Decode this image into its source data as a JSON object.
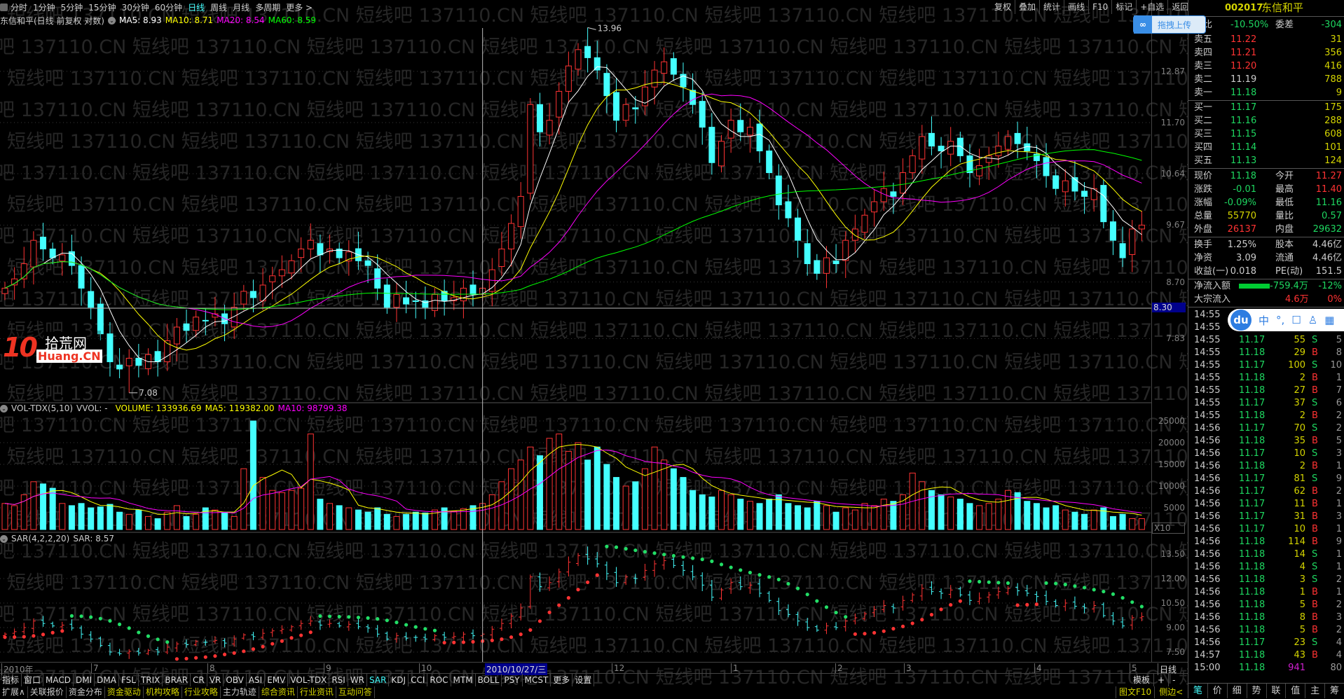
{
  "watermark": "短线吧 137110.CN",
  "top_menu": {
    "left": [
      "分时",
      "1分钟",
      "5分钟",
      "15分钟",
      "30分钟",
      "60分钟",
      "日线",
      "周线",
      "月线",
      "多周期",
      "更多 >"
    ],
    "active": "日线",
    "right": [
      "复权",
      "叠加",
      "统计",
      "画线",
      "F10",
      "标记",
      "+自选",
      "返回"
    ]
  },
  "title": {
    "name": "东信和平(日线 前复权 对数)",
    "ma5": "MA5: 8.93",
    "ma10": "MA10: 8.71",
    "ma20": "MA20: 8.54",
    "ma60": "MA60: 8.59"
  },
  "vol_title": {
    "name": "VOL-TDX(5,10)",
    "vvol": "VVOL: -",
    "volume": "VOLUME: 133936.69",
    "ma5": "MA5: 119382.00",
    "ma10": "MA10: 98799.38"
  },
  "sar_title": {
    "name": "SAR(4,2,2,20)",
    "sar": "SAR: 8.57"
  },
  "colors": {
    "up": "#ff3333",
    "down": "#44ffff",
    "ma5": "#ffffff",
    "ma10": "#ffff00",
    "ma20": "#ff00ff",
    "ma60": "#00ff00"
  },
  "upload_button": "拖拽上传",
  "logo": {
    "text1": "10",
    "text2": "拾荒网",
    "text3": "Huang.CN"
  },
  "chart_data": {
    "type": "candlestick",
    "scale": "log",
    "price_axis": [
      "12.87",
      "11.70",
      "10.64",
      "9.67",
      "8.70",
      "7.83"
    ],
    "crosshair_price": "8.30",
    "max_label": "13.96",
    "min_label": "7.08",
    "vol_axis": [
      "25000",
      "20000",
      "15000",
      "10000",
      "5000"
    ],
    "vol_multiplier": "X10",
    "sar_axis": [
      "13.50",
      "12.00",
      "10.50",
      "9.00",
      "7.50"
    ],
    "x_labels": [
      "2010年",
      "7",
      "8",
      "9",
      "10",
      "12",
      "1",
      "2",
      "3",
      "4",
      "5"
    ],
    "crosshair_date": "2010/10/27/三",
    "period_label": "日线",
    "close": [
      8.6,
      8.75,
      9.0,
      9.4,
      9.25,
      9.1,
      9.15,
      8.97,
      8.6,
      8.3,
      7.9,
      7.5,
      7.4,
      7.55,
      7.45,
      7.6,
      7.5,
      7.8,
      8.0,
      7.95,
      8.15,
      8.1,
      8.2,
      8.05,
      8.3,
      8.55,
      8.45,
      8.65,
      8.8,
      8.9,
      9.05,
      9.25,
      9.4,
      9.15,
      9.25,
      9.1,
      9.2,
      9.05,
      8.97,
      8.6,
      8.3,
      8.5,
      8.35,
      8.4,
      8.3,
      8.5,
      8.4,
      8.45,
      8.6,
      8.5,
      8.6,
      8.9,
      9.25,
      9.7,
      10.2,
      12.1,
      11.5,
      11.75,
      12.4,
      13.0,
      13.4,
      13.2,
      12.9,
      12.3,
      11.75,
      12.1,
      12.0,
      12.5,
      12.9,
      13.1,
      12.8,
      12.5,
      12.1,
      11.6,
      10.86,
      11.3,
      11.75,
      11.5,
      11.6,
      11.1,
      10.66,
      10.04,
      9.8,
      9.4,
      9.0,
      8.84,
      9.1,
      9.0,
      9.4,
      9.6,
      9.85,
      10.1,
      10.35,
      10.2,
      10.66,
      11.0,
      11.4,
      11.2,
      11.1,
      11.3,
      11.0,
      10.66,
      10.8,
      11.0,
      11.2,
      11.4,
      11.25,
      11.1,
      10.9,
      10.6,
      10.35,
      10.5,
      10.3,
      10.2,
      10.35,
      9.73,
      9.4,
      9.1,
      9.6,
      9.67
    ],
    "volume": [
      6000,
      5500,
      8000,
      11000,
      10500,
      9500,
      6000,
      5500,
      6000,
      5000,
      5200,
      5800,
      4000,
      3500,
      4500,
      3000,
      2500,
      4000,
      5500,
      3000,
      3500,
      5000,
      4500,
      4000,
      3000,
      14000,
      25000,
      12000,
      9000,
      8500,
      9000,
      9500,
      22000,
      7000,
      6000,
      5500,
      5000,
      4500,
      4000,
      5000,
      3500,
      3000,
      3500,
      4000,
      3800,
      4500,
      5000,
      4200,
      4800,
      5500,
      6000,
      8000,
      11000,
      14000,
      16000,
      19000,
      17000,
      21000,
      22000,
      18000,
      20000,
      16000,
      19000,
      15000,
      12000,
      10000,
      11000,
      14000,
      19000,
      16000,
      14000,
      12000,
      9000,
      8000,
      7500,
      9000,
      8000,
      7000,
      6500,
      6000,
      7000,
      8000,
      6000,
      5500,
      5000,
      6500,
      5500,
      4000,
      5000,
      4500,
      6000,
      5500,
      7000,
      6500,
      8000,
      13000,
      11000,
      9000,
      8000,
      7500,
      7000,
      6000,
      5500,
      6000,
      7000,
      9000,
      8500,
      6500,
      6000,
      5000,
      5500,
      4500,
      4000,
      3500,
      4500,
      5000,
      3000,
      3500,
      2500,
      2500
    ]
  },
  "tabs": [
    "指标",
    "窗口",
    "MACD",
    "DMI",
    "DMA",
    "FSL",
    "TRIX",
    "BRAR",
    "CR",
    "VR",
    "OBV",
    "ASI",
    "EMV",
    "VOL-TDX",
    "RSI",
    "WR",
    "SAR",
    "KDJ",
    "CCI",
    "ROC",
    "MTM",
    "BOLL",
    "PSY",
    "MCST",
    "更多",
    "设置"
  ],
  "active_tab": "SAR",
  "template": {
    "label": "模板",
    "plus": "+",
    "minus": "-"
  },
  "ext": [
    {
      "t": "扩展∧",
      "c": "w"
    },
    {
      "t": "关联报价",
      "c": "w"
    },
    {
      "t": "资金分布",
      "c": "w"
    },
    {
      "t": "资金驱动",
      "c": "y"
    },
    {
      "t": "机构攻略",
      "c": "y"
    },
    {
      "t": "行业攻略",
      "c": "y"
    },
    {
      "t": "主力轨迹",
      "c": "w"
    },
    {
      "t": "综合资讯",
      "c": "y"
    },
    {
      "t": "行业资讯",
      "c": "y"
    },
    {
      "t": "互动问答",
      "c": "y"
    }
  ],
  "ext_right": {
    "f10": "图文F10",
    "side": "侧边<"
  },
  "quote": {
    "code": "002017",
    "name": "东信和平",
    "wb_label": "委比",
    "wb": "-10.50%",
    "wc_label": "委差",
    "wc": "-304",
    "sell": [
      {
        "l": "卖五",
        "p": "11.22",
        "pc": "r",
        "v": "31"
      },
      {
        "l": "卖四",
        "p": "11.21",
        "pc": "r",
        "v": "356"
      },
      {
        "l": "卖三",
        "p": "11.20",
        "pc": "r",
        "v": "416"
      },
      {
        "l": "卖二",
        "p": "11.19",
        "pc": "w",
        "v": "788"
      },
      {
        "l": "卖一",
        "p": "11.18",
        "pc": "g",
        "v": "9"
      }
    ],
    "buy": [
      {
        "l": "买一",
        "p": "11.17",
        "pc": "g",
        "v": "175"
      },
      {
        "l": "买二",
        "p": "11.16",
        "pc": "g",
        "v": "288"
      },
      {
        "l": "买三",
        "p": "11.15",
        "pc": "g",
        "v": "608"
      },
      {
        "l": "买四",
        "p": "11.14",
        "pc": "g",
        "v": "101"
      },
      {
        "l": "买五",
        "p": "11.13",
        "pc": "g",
        "v": "124"
      }
    ],
    "stats": [
      {
        "l1": "现价",
        "v1": "11.18",
        "c1": "g",
        "l2": "今开",
        "v2": "11.27",
        "c2": "r"
      },
      {
        "l1": "涨跌",
        "v1": "-0.01",
        "c1": "g",
        "l2": "最高",
        "v2": "11.40",
        "c2": "r"
      },
      {
        "l1": "涨幅",
        "v1": "-0.09%",
        "c1": "g",
        "l2": "最低",
        "v2": "11.16",
        "c2": "g"
      },
      {
        "l1": "总量",
        "v1": "55770",
        "c1": "y",
        "l2": "量比",
        "v2": "0.57",
        "c2": "g"
      },
      {
        "l1": "外盘",
        "v1": "26137",
        "c1": "r",
        "l2": "内盘",
        "v2": "29632",
        "c2": "g"
      }
    ],
    "fund": [
      {
        "l1": "换手",
        "v1": "1.25%",
        "l2": "股本",
        "v2": "4.46亿"
      },
      {
        "l1": "净资",
        "v1": "3.09",
        "l2": "流通",
        "v2": "4.46亿"
      },
      {
        "l1": "收益(一)",
        "v1": "0.018",
        "l2": "PE(动)",
        "v2": "151.5"
      }
    ],
    "netflow": {
      "label": "净流入额",
      "value": "-759.4万",
      "pct": "-12%"
    },
    "block": {
      "label": "大宗流入",
      "value": "4.6万",
      "pct": "0%"
    }
  },
  "ticks": [
    {
      "t": "14:55",
      "p": "",
      "v": "",
      "d": "",
      "n": ""
    },
    {
      "t": "14:55",
      "p": "",
      "v": "",
      "d": "",
      "n": ""
    },
    {
      "t": "14:55",
      "p": "11.17",
      "v": "55",
      "d": "S",
      "n": "5"
    },
    {
      "t": "14:55",
      "p": "11.18",
      "v": "29",
      "d": "B",
      "n": "8"
    },
    {
      "t": "14:55",
      "p": "11.17",
      "v": "100",
      "d": "S",
      "n": "10"
    },
    {
      "t": "14:55",
      "p": "11.18",
      "v": "2",
      "d": "B",
      "n": "1"
    },
    {
      "t": "14:55",
      "p": "11.18",
      "v": "27",
      "d": "B",
      "n": "7"
    },
    {
      "t": "14:55",
      "p": "11.17",
      "v": "37",
      "d": "S",
      "n": "6"
    },
    {
      "t": "14:55",
      "p": "11.18",
      "v": "2",
      "d": "B",
      "n": "2"
    },
    {
      "t": "14:56",
      "p": "11.17",
      "v": "70",
      "d": "S",
      "n": "2"
    },
    {
      "t": "14:56",
      "p": "11.18",
      "v": "35",
      "d": "B",
      "n": "5"
    },
    {
      "t": "14:56",
      "p": "11.17",
      "v": "10",
      "d": "S",
      "n": "3"
    },
    {
      "t": "14:56",
      "p": "11.18",
      "v": "2",
      "d": "B",
      "n": "1"
    },
    {
      "t": "14:56",
      "p": "11.17",
      "v": "81",
      "d": "S",
      "n": "9"
    },
    {
      "t": "14:56",
      "p": "11.17",
      "v": "62",
      "d": "B",
      "n": "2"
    },
    {
      "t": "14:56",
      "p": "11.17",
      "v": "11",
      "d": "B",
      "n": "1"
    },
    {
      "t": "14:56",
      "p": "11.17",
      "v": "31",
      "d": "B",
      "n": "3"
    },
    {
      "t": "14:56",
      "p": "11.17",
      "v": "10",
      "d": "B",
      "n": "1"
    },
    {
      "t": "14:56",
      "p": "11.18",
      "v": "114",
      "d": "B",
      "n": "9"
    },
    {
      "t": "14:56",
      "p": "11.18",
      "v": "14",
      "d": "S",
      "n": "1"
    },
    {
      "t": "14:56",
      "p": "11.18",
      "v": "4",
      "d": "S",
      "n": "1"
    },
    {
      "t": "14:56",
      "p": "11.18",
      "v": "3",
      "d": "S",
      "n": "2"
    },
    {
      "t": "14:56",
      "p": "11.18",
      "v": "1",
      "d": "B",
      "n": "1"
    },
    {
      "t": "14:56",
      "p": "11.18",
      "v": "5",
      "d": "B",
      "n": "2"
    },
    {
      "t": "14:56",
      "p": "11.18",
      "v": "8",
      "d": "B",
      "n": "3"
    },
    {
      "t": "14:56",
      "p": "11.18",
      "v": "5",
      "d": "B",
      "n": "2"
    },
    {
      "t": "14:56",
      "p": "11.17",
      "v": "23",
      "d": "S",
      "n": "4"
    },
    {
      "t": "14:57",
      "p": "11.18",
      "v": "43",
      "d": "B",
      "n": "4"
    },
    {
      "t": "15:00",
      "p": "11.18",
      "v": "941",
      "d": "",
      "n": "80"
    }
  ],
  "bottom_tabs": [
    "笔",
    "价",
    "细",
    "势",
    "联",
    "值",
    "主",
    "筹"
  ],
  "ime": {
    "logo": "du",
    "lang": "中"
  }
}
